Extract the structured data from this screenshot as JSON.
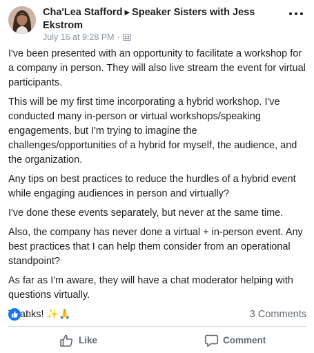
{
  "post": {
    "author": "Cha'Lea Stafford",
    "group": "Speaker Sisters with Jess Ekstrom",
    "timestamp": "July 16 at 9:28 PM",
    "paragraphs": [
      "I've been presented with an opportunity to facilitate a workshop for a company in person. They will also live stream the event for virtual participants.",
      "This will be my first time incorporating a hybrid workshop. I've conducted many in-person or virtual workshops/speaking engagements, but I'm trying to imagine the challenges/opportunities of a hybrid for myself, the audience, and the organization.",
      "Any tips on best practices to reduce the hurdles of a hybrid event while engaging audiences in person and virtually?",
      "I've done these events separately, but never at the same time.",
      "Also, the company has never done a virtual + in-person event. Any best practices that I can help them consider from an operational standpoint?",
      "As far as I'm aware, they will have a chat moderator helping with questions virtually."
    ],
    "closing": "Thanks!",
    "closing_emoji": "✨🙏"
  },
  "stats": {
    "like_count": "1",
    "comment_count": "3 Comments"
  },
  "actions": {
    "like_label": "Like",
    "comment_label": "Comment"
  },
  "colors": {
    "accent": "#1877f2",
    "muted": "#606770",
    "meta": "#8d949e"
  },
  "icons": {
    "visibility": "group-icon",
    "more": "more-options-icon",
    "reaction": "thumbs-up-icon",
    "like": "like-icon",
    "comment": "comment-icon"
  }
}
